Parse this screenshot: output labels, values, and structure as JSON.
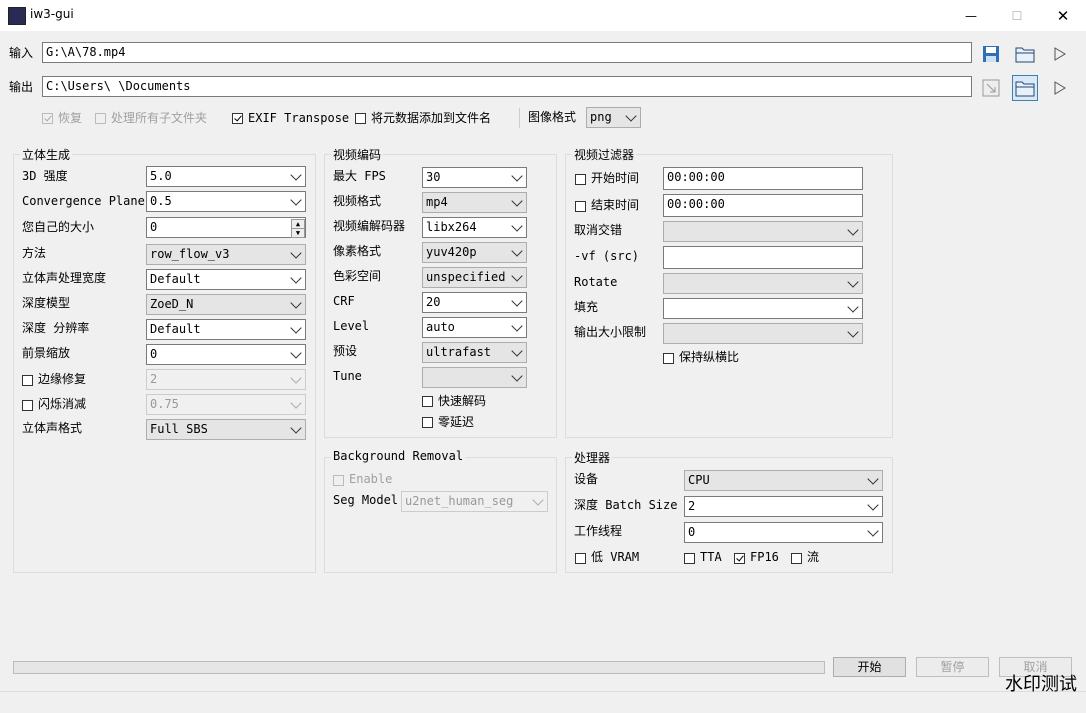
{
  "window": {
    "title": "iw3-gui",
    "minimize": "—",
    "maximize": "☐",
    "close": "✕"
  },
  "io": {
    "input_label": "输入",
    "input_value": "G:\\A\\78.mp4",
    "output_label": "输出",
    "output_value": "C:\\Users\\            \\Documents"
  },
  "options": {
    "resume": "恢复",
    "recursive": "处理所有子文件夹",
    "exif": "EXIF Transpose",
    "metadata": "将元数据添加到文件名",
    "image_format_label": "图像格式",
    "image_format": "png"
  },
  "stereo": {
    "title": "立体生成",
    "strength_label": "3D 强度",
    "strength": "5.0",
    "convergence_label": "Convergence Plane",
    "convergence": "0.5",
    "ipd_label": "您自己的大小",
    "ipd": "0",
    "method_label": "方法",
    "method": "row_flow_v3",
    "stereo_width_label": "立体声处理宽度",
    "stereo_width": "Default",
    "depth_model_label": "深度模型",
    "depth_model": "ZoeD_N",
    "depth_res_label": "深度 分辨率",
    "depth_res": "Default",
    "fg_scale_label": "前景缩放",
    "fg_scale": "0",
    "edge_fix_label": "边缘修复",
    "edge_fix": "2",
    "flicker_label": "闪烁消减",
    "flicker": "0.75",
    "format_label": "立体声格式",
    "format": "Full SBS"
  },
  "video": {
    "title": "视频编码",
    "max_fps_label": "最大 FPS",
    "max_fps": "30",
    "format_label": "视频格式",
    "format": "mp4",
    "codec_label": "视频编解码器",
    "codec": "libx264",
    "pix_fmt_label": "像素格式",
    "pix_fmt": "yuv420p",
    "colorspace_label": "色彩空间",
    "colorspace": "unspecified",
    "crf_label": "CRF",
    "crf": "20",
    "level_label": "Level",
    "level": "auto",
    "preset_label": "预设",
    "preset": "ultrafast",
    "tune_label": "Tune",
    "tune": "",
    "fast_decode": "快速解码",
    "zero_latency": "零延迟"
  },
  "filter": {
    "title": "视频过滤器",
    "start_label": "开始时间",
    "start": "00:00:00",
    "end_label": "结束时间",
    "end": "00:00:00",
    "deinterlace_label": "取消交错",
    "vf_label": "-vf (src)",
    "rotate_label": "Rotate",
    "pad_label": "填充",
    "max_size_label": "输出大小限制",
    "keep_aspect": "保持纵横比"
  },
  "bg": {
    "title": "Background Removal",
    "enable": "Enable",
    "seg_label": "Seg Model",
    "seg": "u2net_human_seg"
  },
  "proc": {
    "title": "处理器",
    "device_label": "设备",
    "device": "CPU",
    "batch_label": "深度 Batch Size",
    "batch": "2",
    "workers_label": "工作线程",
    "workers": "0",
    "low_vram": "低 VRAM",
    "tta": "TTA",
    "fp16": "FP16",
    "stream": "流"
  },
  "actions": {
    "start": "开始",
    "pause": "暂停",
    "cancel": "取消"
  },
  "progress": 0,
  "watermark": "水印测试"
}
